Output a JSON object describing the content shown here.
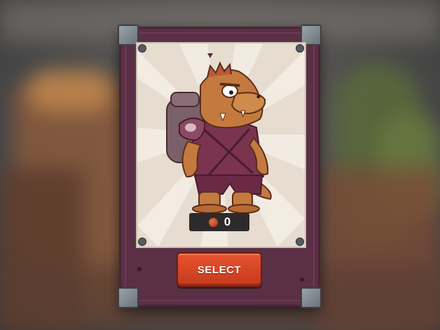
{
  "card": {
    "cost": {
      "icon": "coin-icon",
      "value": "0"
    },
    "select_label": "SELECT",
    "character": "crocodile-backpacker-character"
  },
  "colors": {
    "card_frame": "#5b2f45",
    "button": "#d8472a",
    "portrait_bg": "#e6ddd0"
  }
}
